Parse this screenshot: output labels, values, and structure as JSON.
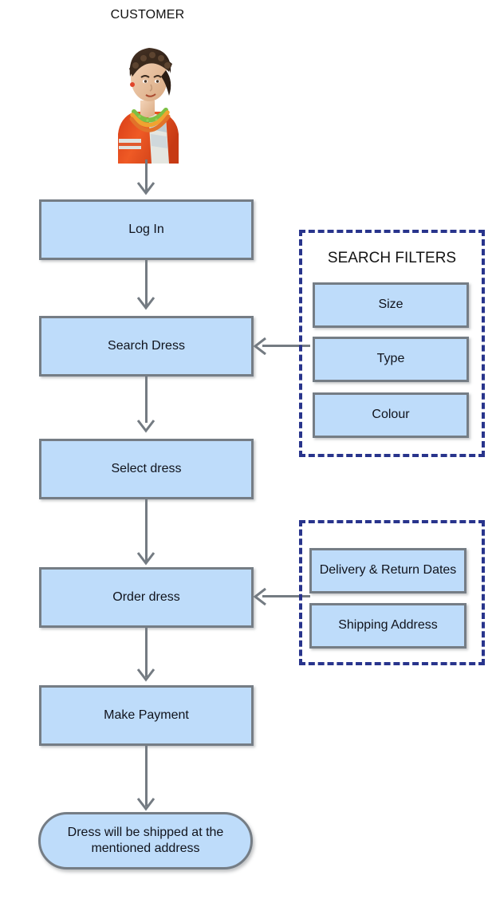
{
  "diagram": {
    "title": "CUSTOMER",
    "avatar_label": "customer-avatar",
    "colors": {
      "node_fill": "#bedcfa",
      "node_border": "#757d85",
      "dashed_border": "#28348c",
      "connector": "#747b82",
      "text": "#10131c"
    },
    "flow": [
      {
        "id": "login",
        "label": "Log In"
      },
      {
        "id": "search",
        "label": "Search Dress"
      },
      {
        "id": "select",
        "label": "Select dress"
      },
      {
        "id": "order",
        "label": "Order dress"
      },
      {
        "id": "payment",
        "label": "Make Payment"
      }
    ],
    "terminator": {
      "label": "Dress will be shipped at the mentioned address"
    },
    "panels": [
      {
        "id": "search-filters",
        "title": "SEARCH FILTERS",
        "items": [
          {
            "label": "Size"
          },
          {
            "label": "Type"
          },
          {
            "label": "Colour"
          }
        ]
      },
      {
        "id": "order-details",
        "title": "",
        "items": [
          {
            "label": "Delivery & Return Dates"
          },
          {
            "label": "Shipping Address"
          }
        ]
      }
    ]
  }
}
